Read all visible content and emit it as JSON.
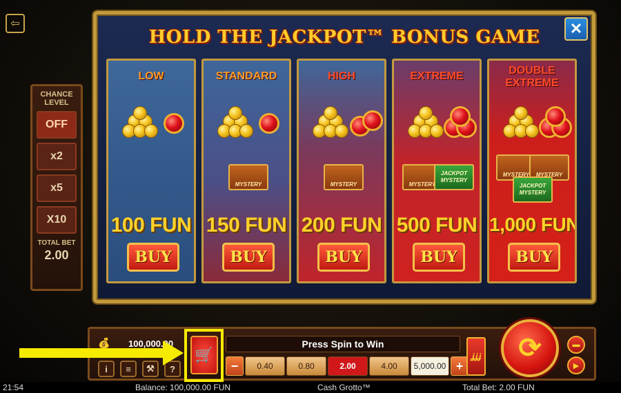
{
  "modal": {
    "title": "HOLD THE JACKPOT™ BONUS GAME",
    "close_glyph": "✕",
    "cards": [
      {
        "tier": "LOW",
        "price": "100 FUN",
        "buy": "BUY",
        "coin_stacks": 1,
        "rubies": 1,
        "chests": []
      },
      {
        "tier": "STANDARD",
        "price": "150 FUN",
        "buy": "BUY",
        "coin_stacks": 1,
        "rubies": 1,
        "chests": [
          "MYSTERY"
        ]
      },
      {
        "tier": "HIGH",
        "price": "200 FUN",
        "buy": "BUY",
        "coin_stacks": 1,
        "rubies": 2,
        "chests": [
          "MYSTERY"
        ]
      },
      {
        "tier": "EXTREME",
        "price": "500 FUN",
        "buy": "BUY",
        "coin_stacks": 1,
        "rubies": 3,
        "chests": [
          "MYSTERY",
          "JACKPOT MYSTERY"
        ]
      },
      {
        "tier": "DOUBLE EXTREME",
        "price": "1,000 FUN",
        "buy": "BUY",
        "coin_stacks": 1,
        "rubies": 3,
        "chests": [
          "MYSTERY",
          "MYSTERY",
          "JACKPOT MYSTERY"
        ]
      }
    ]
  },
  "chance_level": {
    "title": "CHANCE LEVEL",
    "options": [
      "OFF",
      "x2",
      "x5",
      "X10"
    ],
    "selected": "OFF",
    "total_bet_label": "TOTAL BET",
    "total_bet_value": "2.00"
  },
  "control_bar": {
    "balance_top": "100,000.00",
    "status_message": "Press Spin to Win",
    "bet_minus": "−",
    "bet_plus": "+",
    "bet_options": [
      "0.40",
      "0.80",
      "2.00",
      "4.00",
      "5,000.00"
    ],
    "selected_bet": "2.00",
    "autoplay_label": "ʝʝʝ",
    "info_glyph": "i",
    "menu_glyph": "≡",
    "help_glyph": "?",
    "cart_glyph": "🛒",
    "spin_glyph": "⟳"
  },
  "status_strip": {
    "time": "21:54",
    "balance": "Balance: 100,000.00 FUN",
    "game_name": "Cash Grotto™",
    "total_bet": "Total Bet: 2.00 FUN"
  },
  "colors": {
    "highlight": "#f5ea00",
    "accent_gold": "#c29a3c",
    "buy_red": "#c01a12"
  }
}
